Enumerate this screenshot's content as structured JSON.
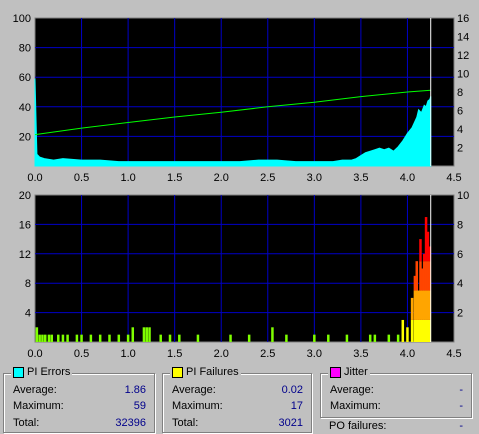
{
  "chart_data": [
    {
      "type": "area",
      "xlim": [
        0,
        4.5
      ],
      "ylim": [
        0,
        100
      ],
      "y2lim": [
        0,
        16
      ],
      "x_ticks": [
        "0.0",
        "0.5",
        "1.0",
        "1.5",
        "2.0",
        "2.5",
        "3.0",
        "3.5",
        "4.0",
        "4.5"
      ],
      "y_ticks": [
        "100",
        "80",
        "60",
        "40",
        "20"
      ],
      "y2_ticks": [
        "16",
        "14",
        "12",
        "10",
        "8",
        "6",
        "4",
        "2"
      ],
      "grid": true,
      "series": [
        {
          "color": "#00ffff",
          "x": [
            0.0,
            0.02,
            0.05,
            0.1,
            0.2,
            0.3,
            0.5,
            0.7,
            0.9,
            1.0,
            1.2,
            1.4,
            1.6,
            1.8,
            2.0,
            2.2,
            2.4,
            2.6,
            2.8,
            3.0,
            3.2,
            3.3,
            3.4,
            3.45,
            3.5,
            3.55,
            3.6,
            3.65,
            3.7,
            3.75,
            3.8,
            3.85,
            3.9,
            3.95,
            4.0,
            4.05,
            4.1,
            4.12,
            4.15,
            4.18,
            4.2,
            4.22,
            4.24,
            4.25
          ],
          "values": [
            59,
            8,
            6,
            5,
            4,
            5,
            4,
            4,
            3,
            3,
            3,
            3,
            3,
            3,
            3,
            3,
            4,
            4,
            3,
            3,
            3,
            4,
            4,
            5,
            7,
            9,
            10,
            11,
            12,
            11,
            12,
            10,
            13,
            17,
            22,
            26,
            33,
            38,
            36,
            41,
            40,
            44,
            45,
            47
          ]
        },
        {
          "color": "#00ff00",
          "axis": "right",
          "x": [
            0.0,
            0.5,
            1.0,
            1.5,
            2.0,
            2.5,
            3.0,
            3.5,
            4.0,
            4.25
          ],
          "values": [
            3.4,
            4.1,
            4.7,
            5.3,
            5.8,
            6.4,
            6.9,
            7.5,
            8.0,
            8.2
          ]
        }
      ]
    },
    {
      "type": "bar",
      "xlim": [
        0,
        4.5
      ],
      "ylim": [
        0,
        20
      ],
      "y2lim": [
        0,
        10
      ],
      "x_ticks": [
        "0.0",
        "0.5",
        "1.0",
        "1.5",
        "2.0",
        "2.5",
        "3.0",
        "3.5",
        "4.0",
        "4.5"
      ],
      "y_ticks": [
        "20",
        "16",
        "12",
        "8",
        "4"
      ],
      "y2_ticks": [
        "10",
        "8",
        "6",
        "4",
        "2"
      ],
      "grid": true,
      "series": [
        {
          "x": [
            0.02,
            0.05,
            0.08,
            0.11,
            0.15,
            0.18,
            0.25,
            0.3,
            0.35,
            0.45,
            0.5,
            0.6,
            0.7,
            0.8,
            0.9,
            1.0,
            1.05,
            1.17,
            1.2,
            1.23,
            1.35,
            1.45,
            1.55,
            1.75,
            2.1,
            2.3,
            2.55,
            2.7,
            3.0,
            3.15,
            3.35,
            3.6,
            3.65,
            3.8,
            3.9,
            3.95,
            4.0,
            4.05,
            4.08,
            4.1,
            4.12,
            4.14,
            4.16,
            4.18,
            4.2,
            4.22,
            4.24
          ],
          "values": [
            2,
            1,
            1,
            1,
            1,
            1,
            1,
            1,
            1,
            1,
            1,
            1,
            1,
            1,
            1,
            1,
            2,
            2,
            2,
            2,
            1,
            1,
            1,
            1,
            1,
            1,
            2,
            1,
            1,
            1,
            1,
            1,
            1,
            1,
            1,
            3,
            2,
            6,
            9,
            11,
            7,
            14,
            10,
            12,
            17,
            15,
            13
          ]
        }
      ]
    }
  ],
  "stats": {
    "pi_errors": {
      "title": "PI Errors",
      "swatch": "#00ffff",
      "average_label": "Average:",
      "average": "1.86",
      "maximum_label": "Maximum:",
      "maximum": "59",
      "total_label": "Total:",
      "total": "32396"
    },
    "pi_failures": {
      "title": "PI Failures",
      "swatch": "#ffff00",
      "average_label": "Average:",
      "average": "0.02",
      "maximum_label": "Maximum:",
      "maximum": "17",
      "total_label": "Total:",
      "total": "3021"
    },
    "jitter": {
      "title": "Jitter",
      "swatch": "#ff00ff",
      "average_label": "Average:",
      "average": "-",
      "maximum_label": "Maximum:",
      "maximum": "-"
    },
    "po_failures": {
      "label": "PO failures:",
      "value": "-"
    }
  }
}
